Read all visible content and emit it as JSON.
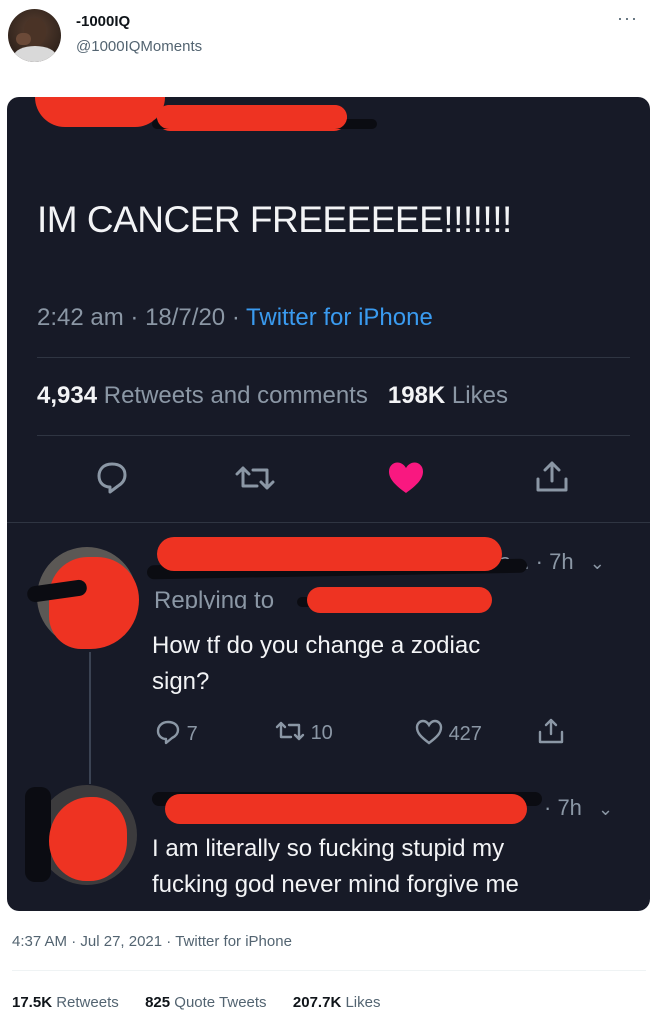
{
  "author": {
    "name": "-1000IQ",
    "handle": "@1000IQMoments"
  },
  "more_icon": "more-horizontal-icon",
  "screenshot": {
    "tweet_text": "IM CANCER FREEEEEE!!!!!!!",
    "time": "2:42 am",
    "date": "18/7/20",
    "source": "Twitter for iPhone",
    "retweets_count": "4,934",
    "retweets_label": "Retweets and comments",
    "likes_count": "198K",
    "likes_label": "Likes",
    "like_color": "#f91880",
    "link_color": "#3a9bf0",
    "redact_color": "#ee3322",
    "reply1": {
      "meta": "a... · 7h",
      "replying_label": "Replying to",
      "text_line1": "How tf do you change a zodiac",
      "text_line2": "sign?",
      "replies": "7",
      "retweets": "10",
      "likes": "427"
    },
    "reply2": {
      "meta": "· 7h",
      "text_line1": "I am literally so fucking stupid my",
      "text_line2": "fucking god never mind forgive me"
    }
  },
  "footer": {
    "time": "4:37 AM",
    "date": "Jul 27, 2021",
    "source": "Twitter for iPhone",
    "retweets_count": "17.5K",
    "retweets_label": "Retweets",
    "quotes_count": "825",
    "quotes_label": "Quote Tweets",
    "likes_count": "207.7K",
    "likes_label": "Likes"
  }
}
